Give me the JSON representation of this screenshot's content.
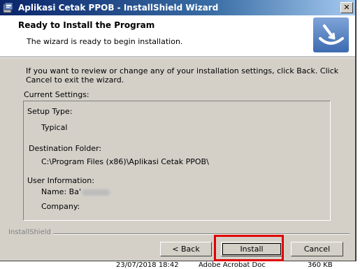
{
  "window": {
    "title": "Aplikasi Cetak PPOB - InstallShield Wizard",
    "close_glyph": "✕"
  },
  "header": {
    "title": "Ready to Install the Program",
    "subtitle": "The wizard is ready to begin installation.",
    "logo_icon": "installshield-logo-icon"
  },
  "body": {
    "intro": "If you want to review or change any of your installation settings, click Back. Click Cancel to exit the wizard.",
    "current_settings_label": "Current Settings:",
    "settings": {
      "setup_type_label": "Setup Type:",
      "setup_type_value": "Typical",
      "destination_label": "Destination Folder:",
      "destination_value": "C:\\Program Files (x86)\\Aplikasi Cetak PPOB\\",
      "user_info_label": "User Information:",
      "name_label": "Name: Ba'",
      "company_label": "Company:"
    }
  },
  "footer": {
    "brand": "InstallShield",
    "back_label": "< Back",
    "install_label": "Install",
    "cancel_label": "Cancel"
  },
  "background": {
    "date_text": "23/07/2018 18:42",
    "app_text": "Adobe Acrobat Doc",
    "size_text": "360 KB"
  }
}
